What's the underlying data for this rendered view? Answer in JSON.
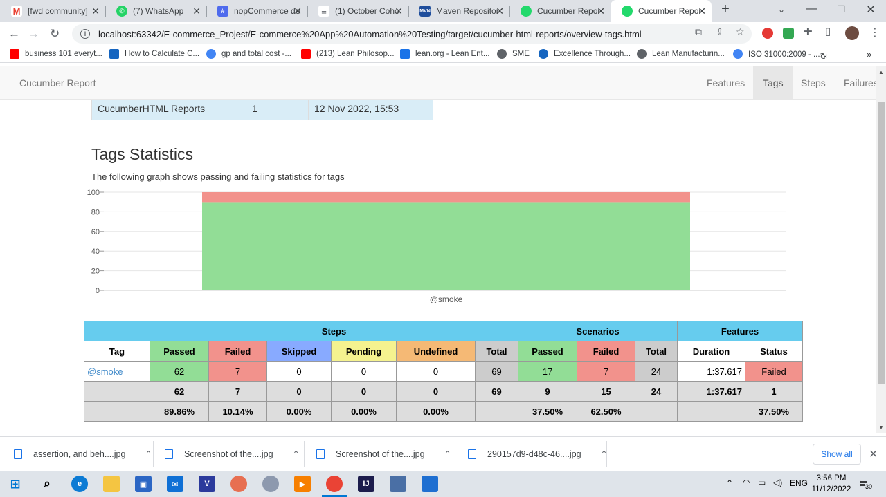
{
  "browser": {
    "tabs": [
      {
        "title": "[fwd community]",
        "icon": "gmail-icon",
        "color": "#ea4335",
        "active": false
      },
      {
        "title": "(7) WhatsApp",
        "icon": "whatsapp-icon",
        "color": "#25d366",
        "active": false
      },
      {
        "title": "nopCommerce de",
        "icon": "nopcommerce-icon",
        "color": "#4f6bed",
        "active": false
      },
      {
        "title": "(1) October Coho",
        "icon": "doc-icon",
        "color": "#5f6368",
        "active": false
      },
      {
        "title": "Maven Repositor",
        "icon": "maven-icon",
        "color": "#1f4e9c",
        "active": false
      },
      {
        "title": "Cucumber Repor",
        "icon": "cucumber-icon",
        "color": "#23d96c",
        "active": false
      },
      {
        "title": "Cucumber Repor",
        "icon": "cucumber-icon",
        "color": "#23d96c",
        "active": true
      }
    ],
    "address": "localhost:63342/E-commerce_Projest/E-commerce%20App%20Automation%20Testing/target/cucumber-html-reports/overview-tags.html",
    "bookmarks": [
      {
        "label": "business 101 everyt...",
        "color": "#ff0000"
      },
      {
        "label": "How to Calculate C...",
        "color": "#1565c0"
      },
      {
        "label": "gp and total cost -...",
        "color": "#4285f4"
      },
      {
        "label": "(213) Lean Philosop...",
        "color": "#ff0000"
      },
      {
        "label": "lean.org - Lean Ent...",
        "color": "#1a73e8"
      },
      {
        "label": "SME",
        "color": "#5f6368"
      },
      {
        "label": "Excellence Through...",
        "color": "#1565c0"
      },
      {
        "label": "Lean Manufacturin...",
        "color": "#5f6368"
      },
      {
        "label": "ISO 31000:2009 - ...بح",
        "color": "#4285f4"
      }
    ]
  },
  "page": {
    "brand": "Cucumber Report",
    "nav": [
      "Features",
      "Tags",
      "Steps",
      "Failures"
    ],
    "report_row": {
      "name": "CucumberHTML Reports",
      "number": "1",
      "date": "12 Nov 2022, 15:53"
    },
    "title": "Tags Statistics",
    "description": "The following graph shows passing and failing statistics for tags"
  },
  "chart_data": {
    "type": "area",
    "categories": [
      "@smoke"
    ],
    "series": [
      {
        "values": [
          89.86
        ],
        "color": "#92dd96"
      },
      {
        "values": [
          10.14
        ],
        "color": "#f2928c"
      }
    ],
    "ylim": [
      0,
      100
    ],
    "yticks": [
      "0",
      "20",
      "40",
      "60",
      "80",
      "100"
    ],
    "stacked": true,
    "grid": true
  },
  "table": {
    "group_headers": {
      "steps": "Steps",
      "scenarios": "Scenarios",
      "features": "Features"
    },
    "headers": {
      "tag": "Tag",
      "passed": "Passed",
      "failed": "Failed",
      "skipped": "Skipped",
      "pending": "Pending",
      "undefined": "Undefined",
      "total": "Total",
      "sc_passed": "Passed",
      "sc_failed": "Failed",
      "sc_total": "Total",
      "duration": "Duration",
      "status": "Status"
    },
    "row": {
      "tag": "@smoke",
      "passed": "62",
      "failed": "7",
      "skipped": "0",
      "pending": "0",
      "undefined": "0",
      "total": "69",
      "sc_passed": "17",
      "sc_failed": "7",
      "sc_total": "24",
      "duration": "1:37.617",
      "status": "Failed"
    },
    "totals": {
      "passed": "62",
      "failed": "7",
      "skipped": "0",
      "pending": "0",
      "undefined": "0",
      "total": "69",
      "sc_passed": "9",
      "sc_failed": "15",
      "sc_total": "24",
      "duration": "1:37.617",
      "status": "1"
    },
    "percent": {
      "passed": "89.86%",
      "failed": "10.14%",
      "skipped": "0.00%",
      "pending": "0.00%",
      "undefined": "0.00%",
      "sc_passed": "37.50%",
      "sc_failed": "62.50%",
      "status": "37.50%"
    }
  },
  "downloads": {
    "items": [
      "assertion, and beh....jpg",
      "Screenshot of the....jpg",
      "Screenshot of the....jpg",
      "290157d9-d48c-46....jpg"
    ],
    "show_all": "Show all"
  },
  "taskbar": {
    "language": "ENG",
    "time": "3:56 PM",
    "date": "11/12/2022",
    "notifications": "30"
  }
}
